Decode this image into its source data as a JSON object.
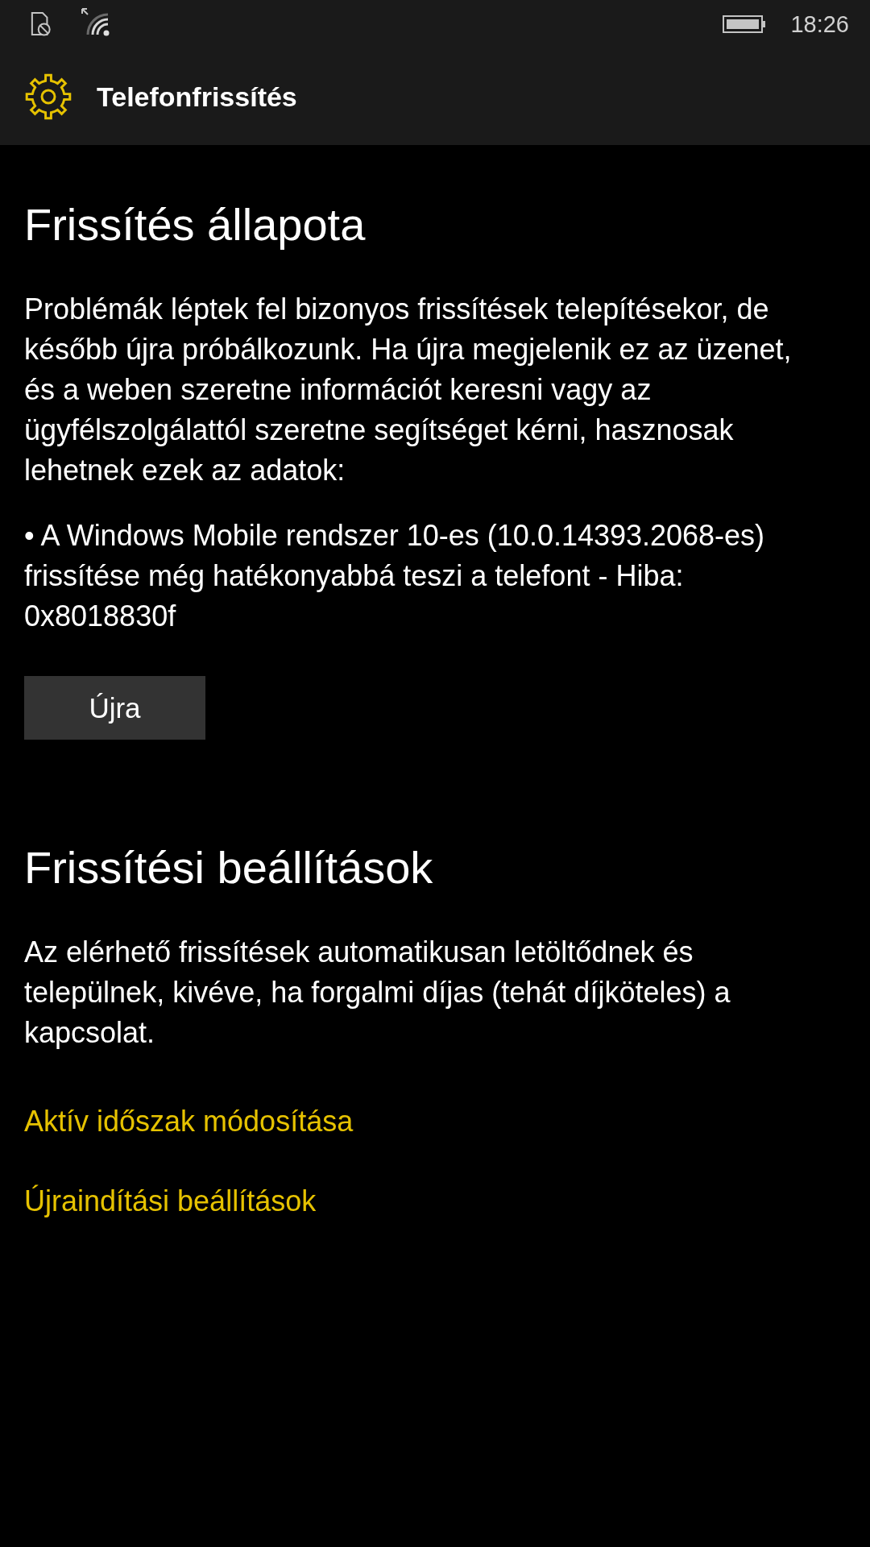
{
  "status_bar": {
    "time": "18:26"
  },
  "header": {
    "title": "Telefonfrissítés"
  },
  "sections": [
    {
      "heading": "Frissítés állapota",
      "paragraphs": [
        "Problémák léptek fel bizonyos frissítések telepítésekor, de később újra próbálkozunk. Ha újra megjelenik ez az üzenet, és a weben szeretne információt keresni vagy az ügyfélszolgálattól szeretne segítséget kérni, hasznosak lehetnek ezek az adatok:",
        "• A Windows Mobile rendszer 10-es (10.0.14393.2068-es) frissítése még hatékonyabbá teszi a telefont - Hiba: 0x8018830f"
      ],
      "button": "Újra"
    },
    {
      "heading": "Frissítési beállítások",
      "paragraphs": [
        "Az elérhető frissítések automatikusan letöltődnek és települnek, kivéve, ha forgalmi díjas (tehát díjköteles) a kapcsolat."
      ],
      "links": [
        "Aktív időszak módosítása",
        "Újraindítási beállítások"
      ]
    }
  ]
}
